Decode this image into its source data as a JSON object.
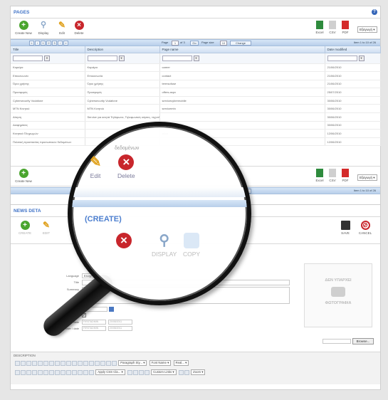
{
  "pages_panel": {
    "title": "PAGES",
    "toolbar": {
      "create_new": "Create New",
      "display": "Display",
      "edit": "Edit",
      "delete": "Delete",
      "excel": "Excel",
      "csv": "CSV",
      "pdf": "PDF",
      "export_select": "Εξαγωγή"
    },
    "pager": {
      "page_label": "Page",
      "page_value": "1",
      "of_label": "of 3",
      "go": "Go",
      "page_size_label": "Page size",
      "page_size_value": "10",
      "change": "Change",
      "item_info": "Item 1 to 10 of 26"
    },
    "columns": [
      "Title",
      "Description",
      "Page name",
      "Date modified"
    ],
    "rows": [
      [
        "Καριέρα",
        "Καριέρα",
        "career",
        "21/06/2010"
      ],
      [
        "Επικοινωνία",
        "Επικοινωνία",
        "contact",
        "21/06/2010"
      ],
      [
        "Όροι χρήσης",
        "Όροι χρήσης",
        "termsofuse",
        "21/06/2010"
      ],
      [
        "Προσφορές",
        "Προσφορές",
        "offers.aspx",
        "25/07/2010"
      ],
      [
        "Cybersecurity Vodafone",
        "Cybersecurity Vodafone",
        "servicecybermobile",
        "30/06/2010"
      ],
      [
        "MTN Κινητού",
        "MTN Κινητού",
        "servicemtn",
        "30/06/2010"
      ],
      [
        "Αίτηση",
        "Service για κινητά Τηλέφωνα, Τηλεφωνικές κάρτες, τεχνολογία",
        "",
        "30/06/2010"
      ],
      [
        "Διαφημίσεις",
        "",
        "advertisements",
        "30/06/2010"
      ],
      [
        "Κινητικά Πληρωμών",
        "",
        "ation",
        "12/06/2010"
      ],
      [
        "Πολιτική προστασίας προσωπικών δεδομένων",
        "",
        "",
        "12/06/2010"
      ]
    ],
    "bottom_pager": {
      "page_size_label": "Page size",
      "page_size_value": "10",
      "change": "Change",
      "item_info": "Item 1 to 10 of 26"
    }
  },
  "news_panel": {
    "title": "NEWS DETA",
    "toolbar": {
      "create": "CREATE",
      "edit": "EDIT",
      "display": "DISPLAY",
      "copy": "COPY",
      "save": "SAVE",
      "cancel": "CANCEL"
    },
    "form": {
      "language_label": "Language",
      "language_value": "Ελλην...",
      "title_label": "Title",
      "summary_label": "Summary",
      "publish_date_label": "Publish date",
      "publish_label": "Publish",
      "creation_label": "Creation user / date",
      "creation_user": "FIRSTADMIN",
      "creation_date": "20/08/2011",
      "modify_label": "Last modify user / date",
      "modify_user": "FIRSTADMIN",
      "modify_date": "20/08/2011"
    },
    "image_placeholder": {
      "line1": "ΔΕΝ ΥΠΑΡΧΕΙ",
      "line2": "ΦΩΤΟΓΡΑΦΙΑ",
      "browse": "Browse..."
    },
    "description_label": "DESCRIPTION",
    "editor": {
      "paragraph": "Paragraph Sty...",
      "font_name": "Font Name",
      "real": "Real...",
      "apply_css": "Apply CSS Cla...",
      "custom_links": "Custom Links",
      "zoom": "Zoom"
    }
  },
  "magnifier": {
    "overlay_title": "(CREATE)",
    "edit": "Edit",
    "delete": "Delete",
    "partial_text": "δεδομένων",
    "display": "DISPLAY",
    "copy": "COPY"
  },
  "colors": {
    "accent_blue": "#3f72c6",
    "create_green": "#4aa52e",
    "delete_red": "#c8262c",
    "edit_yellow": "#e0a21f"
  }
}
